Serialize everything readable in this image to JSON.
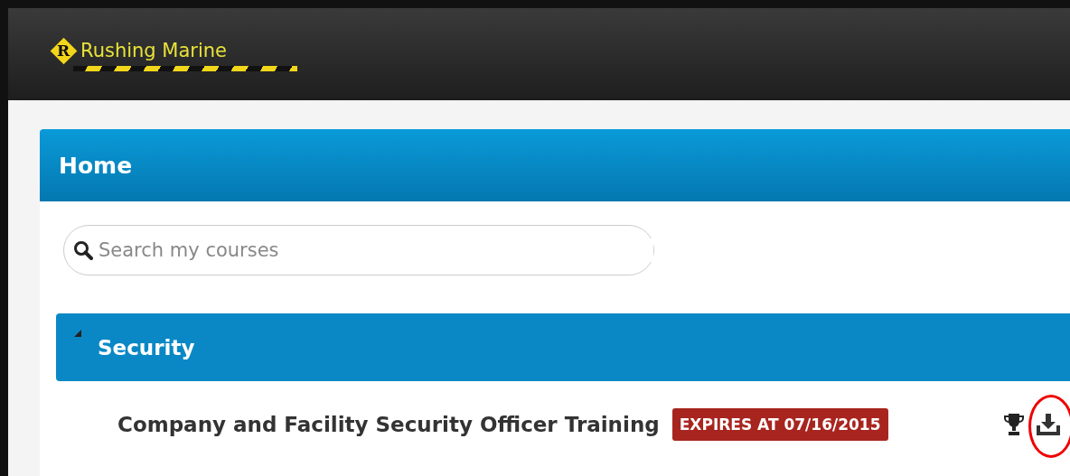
{
  "header": {
    "logo_letter": "R",
    "brand": "Rushing Marine"
  },
  "panel": {
    "title": "Home",
    "search": {
      "placeholder": "Search my courses"
    },
    "sections": [
      {
        "title": "Security",
        "expanded": true,
        "courses": [
          {
            "name": "Company and Facility Security Officer Training",
            "badge": "EXPIRES AT 07/16/2015",
            "download_highlighted": true
          }
        ]
      }
    ]
  }
}
